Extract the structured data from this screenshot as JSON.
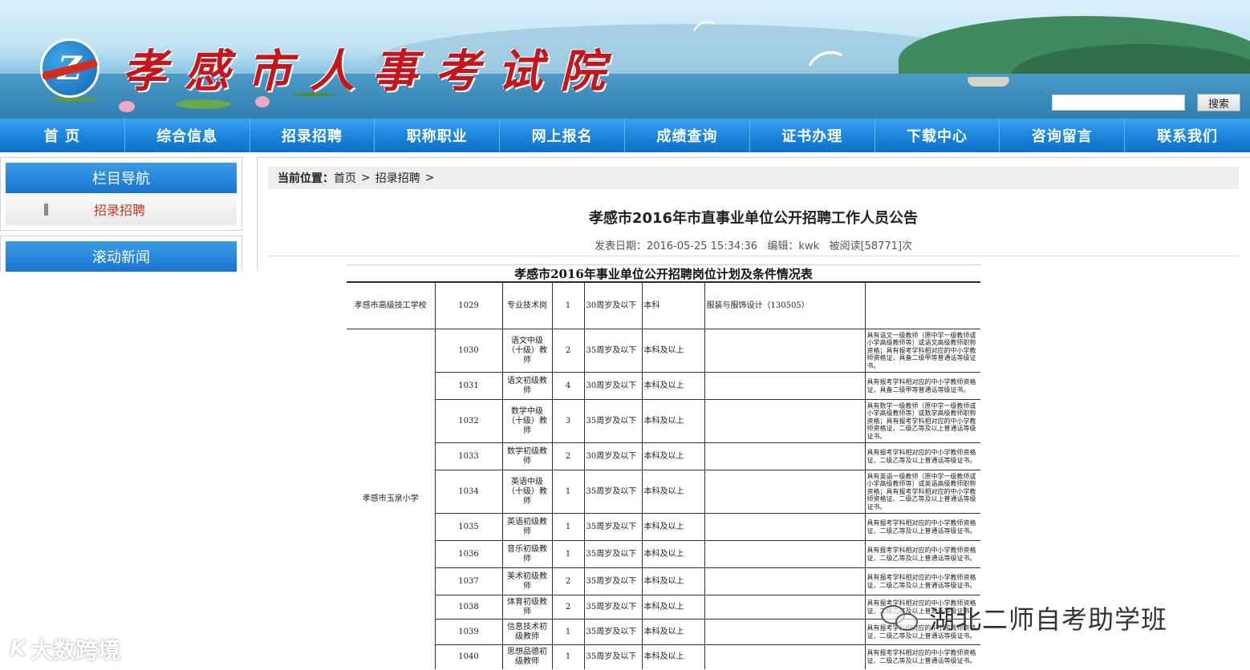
{
  "header": {
    "site_title": "孝感市人事考试院",
    "logo_letter": "Z",
    "search_placeholder": "",
    "search_button": "搜索"
  },
  "nav": [
    "首 页",
    "综合信息",
    "招录招聘",
    "职称职业",
    "网上报名",
    "成绩查询",
    "证书办理",
    "下载中心",
    "咨询留言",
    "联系我们"
  ],
  "sidebar": {
    "nav_title": "栏目导航",
    "nav_item": "招录招聘",
    "news_title": "滚动新闻"
  },
  "breadcrumb": {
    "label": "当前位置：",
    "home": "首页",
    "section": "招录招聘",
    "sep": ">"
  },
  "article": {
    "title": "孝感市2016年市直事业单位公开招聘工作人员公告",
    "meta": "发表日期：2016-05-25 15:34:36   编辑：kwk   被阅读[58771]次"
  },
  "table": {
    "title": "孝感市2016年事业单位公开招聘岗位计划及条件情况表",
    "rows": [
      {
        "unit": "孝感市高级技工学校",
        "code": "1029",
        "post": "专业技术岗",
        "num": "1",
        "age": "30周岁及以下",
        "edu": "本科",
        "major": "服装与服饰设计（130505）",
        "other": ""
      },
      {
        "unit": "孝感市玉泉小学",
        "code": "1030",
        "post": "语文中级（十级）教师",
        "num": "2",
        "age": "35周岁及以下",
        "edu": "本科及以上",
        "major": "",
        "other": "具有语文一级教师（原中学一级教师或\n小学高级教师等）或语文高级教师职称\n资格；具有报考学科相对应的中小学教\n师资格证，具备二级甲等普通话等级证\n书。"
      },
      {
        "unit": "",
        "code": "1031",
        "post": "语文初级教师",
        "num": "4",
        "age": "30周岁及以下",
        "edu": "本科及以上",
        "major": "",
        "other": "具有报考学科相对应的中小学教师资格\n证，具备二级甲等普通话等级证书。"
      },
      {
        "unit": "",
        "code": "1032",
        "post": "数学中级（十级）教师",
        "num": "3",
        "age": "35周岁及以下",
        "edu": "本科及以上",
        "major": "",
        "other": "具有数学一级教师（原中学一级教师或\n小学高级教师等）或数学高级教师职称\n资格；具有报考学科相对应的中小学教\n师资格证，二级乙等及以上普通话等级\n证书。"
      },
      {
        "unit": "",
        "code": "1033",
        "post": "数学初级教师",
        "num": "2",
        "age": "30周岁及以下",
        "edu": "本科及以上",
        "major": "",
        "other": "具有报考学科相对应的中小学教师资格\n证、二级乙等及以上普通话等级证书。"
      },
      {
        "unit": "",
        "code": "1034",
        "post": "英语中级（十级）教师",
        "num": "1",
        "age": "35周岁及以下",
        "edu": "本科及以上",
        "major": "",
        "other": "具有英语一级教师（原中学一级教师或\n小学高级教师等）或英语高级教师职称\n资格；具有报考学科相对应的中小学教\n师资格证、二级乙等及以上普通话等级\n证书。"
      },
      {
        "unit": "",
        "code": "1035",
        "post": "英语初级教师",
        "num": "1",
        "age": "35周岁及以下",
        "edu": "本科及以上",
        "major": "",
        "other": "具有报考学科相对应的中小学教师资格\n证、二级乙等及以上普通话等级证书。"
      },
      {
        "unit": "",
        "code": "1036",
        "post": "音乐初级教师",
        "num": "1",
        "age": "35周岁及以下",
        "edu": "本科及以上",
        "major": "",
        "other": "具有报考学科相对应的中小学教师资格\n证、二级乙等及以上普通话等级证书。"
      },
      {
        "unit": "",
        "code": "1037",
        "post": "美术初级教师",
        "num": "2",
        "age": "35周岁及以下",
        "edu": "本科及以上",
        "major": "",
        "other": "具有报考学科相对应的中小学教师资格\n证、二级乙等及以上普通话等级证书。"
      },
      {
        "unit": "",
        "code": "1038",
        "post": "体育初级教师",
        "num": "2",
        "age": "35周岁及以下",
        "edu": "本科及以上",
        "major": "",
        "other": "具有报考学科相对应的中小学教师资格\n证、二级乙等及以上普通话等级证书。"
      },
      {
        "unit": "",
        "code": "1039",
        "post": "信息技术初级教师",
        "num": "1",
        "age": "35周岁及以下",
        "edu": "本科及以上",
        "major": "",
        "other": "具有报考学科相对应的中小学教师资格\n证、二级乙等及以上普通话等级证书。"
      },
      {
        "unit": "",
        "code": "1040",
        "post": "思想品德初级教师",
        "num": "1",
        "age": "35周岁及以下",
        "edu": "本科及以上",
        "major": "",
        "other": "具有报考学科相对应的中小学教师资格\n证、二级乙等及以上普通话等级证书。"
      }
    ]
  },
  "watermarks": {
    "left_mark": "K",
    "left": "大数跨境",
    "right": "湖北二师自考助学班"
  },
  "colors": {
    "nav_blue": "#1a83db",
    "title_red": "#c4161c",
    "link_red": "#c0392b"
  }
}
